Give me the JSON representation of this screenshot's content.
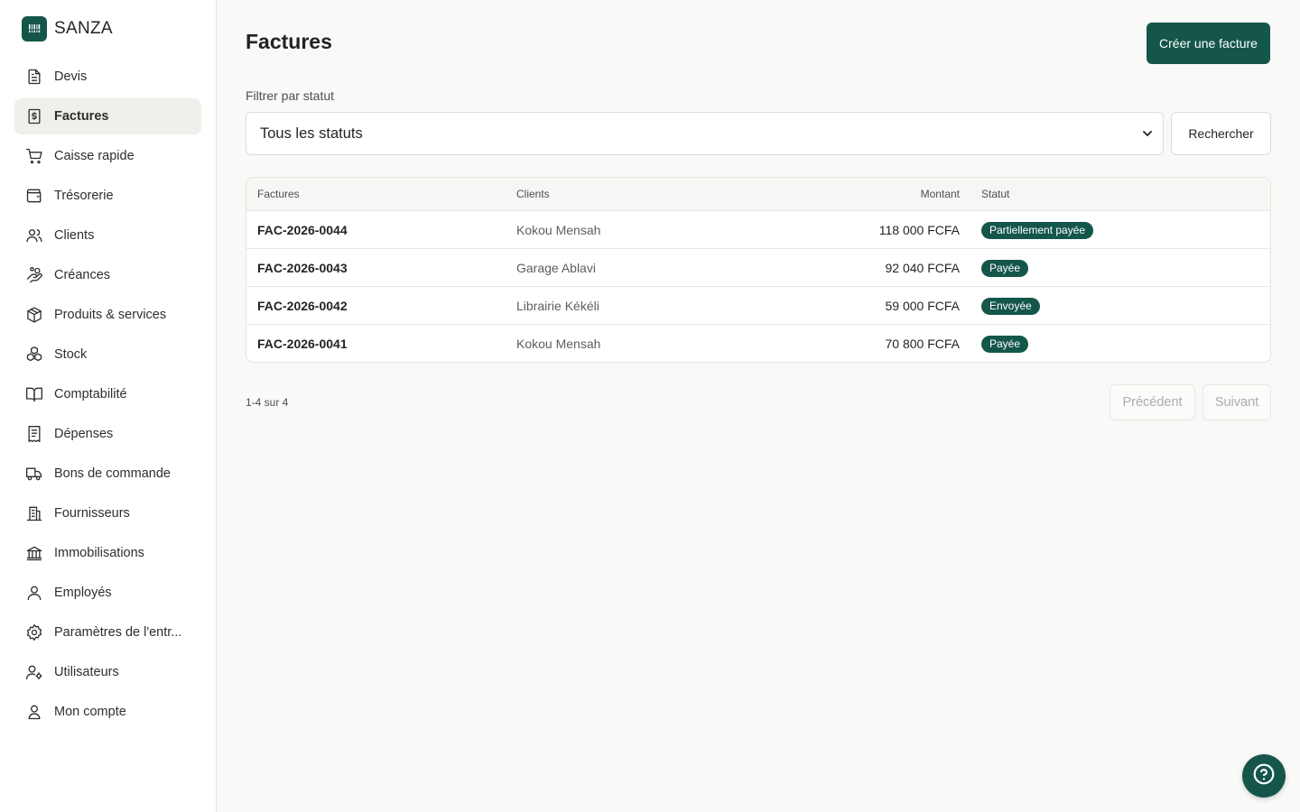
{
  "brand": {
    "name": "SANZA",
    "logo_icon": "cash-register-icon"
  },
  "sidebar": {
    "items": [
      {
        "label": "Devis",
        "icon": "document-icon",
        "active": false
      },
      {
        "label": "Factures",
        "icon": "invoice-dollar-icon",
        "active": true
      },
      {
        "label": "Caisse rapide",
        "icon": "cart-icon",
        "active": false
      },
      {
        "label": "Trésorerie",
        "icon": "wallet-icon",
        "active": false
      },
      {
        "label": "Clients",
        "icon": "users-icon",
        "active": false
      },
      {
        "label": "Créances",
        "icon": "hand-coins-icon",
        "active": false
      },
      {
        "label": "Produits & services",
        "icon": "package-icon",
        "active": false
      },
      {
        "label": "Stock",
        "icon": "boxes-icon",
        "active": false
      },
      {
        "label": "Comptabilité",
        "icon": "book-icon",
        "active": false
      },
      {
        "label": "Dépenses",
        "icon": "receipt-icon",
        "active": false
      },
      {
        "label": "Bons de commande",
        "icon": "truck-icon",
        "active": false
      },
      {
        "label": "Fournisseurs",
        "icon": "building-icon",
        "active": false
      },
      {
        "label": "Immobilisations",
        "icon": "bank-icon",
        "active": false
      },
      {
        "label": "Employés",
        "icon": "user-icon",
        "active": false
      },
      {
        "label": "Paramètres de l'entr...",
        "icon": "gear-icon",
        "active": false
      },
      {
        "label": "Utilisateurs",
        "icon": "user-cog-icon",
        "active": false
      },
      {
        "label": "Mon compte",
        "icon": "account-icon",
        "active": false
      }
    ]
  },
  "header": {
    "title": "Factures",
    "create_button": "Créer une facture"
  },
  "filter": {
    "label": "Filtrer par statut",
    "selected": "Tous les statuts",
    "search_button": "Rechercher"
  },
  "table": {
    "columns": {
      "number": "Factures",
      "client": "Clients",
      "amount": "Montant",
      "status": "Statut"
    },
    "rows": [
      {
        "number": "FAC-2026-0044",
        "client": "Kokou Mensah",
        "amount": "118 000 FCFA",
        "status": "Partiellement payée"
      },
      {
        "number": "FAC-2026-0043",
        "client": "Garage Ablavi",
        "amount": "92 040 FCFA",
        "status": "Payée"
      },
      {
        "number": "FAC-2026-0042",
        "client": "Librairie Kékéli",
        "amount": "59 000 FCFA",
        "status": "Envoyée"
      },
      {
        "number": "FAC-2026-0041",
        "client": "Kokou Mensah",
        "amount": "70 800 FCFA",
        "status": "Payée"
      }
    ]
  },
  "pagination": {
    "info": "1-4 sur 4",
    "prev": "Précédent",
    "next": "Suivant"
  },
  "help": {
    "icon": "help-circle-icon"
  },
  "colors": {
    "accent": "#14564a",
    "background": "#f9f9f7",
    "sidebar_active": "#efefec"
  }
}
